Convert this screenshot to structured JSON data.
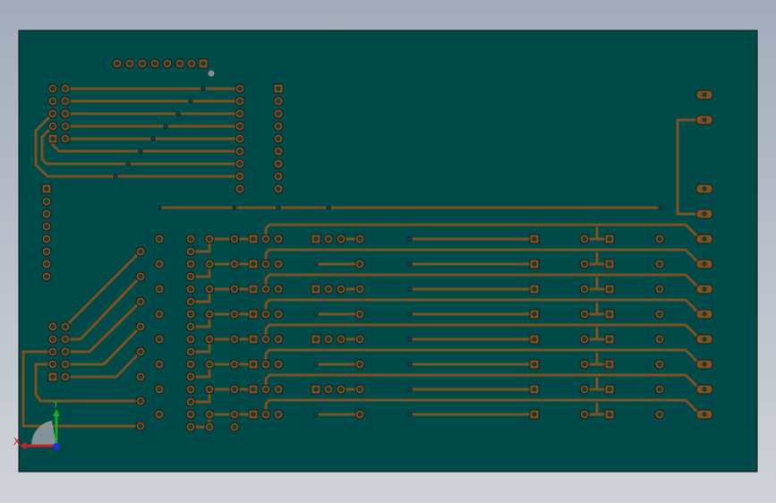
{
  "colors": {
    "board_fill": "#004a4a",
    "board_edge": "#101010",
    "trace": "#7d5120",
    "pad_fill": "#7d5120",
    "pad_hole": "#004a4a",
    "pad_outline": "#1c1c1c",
    "axis_x": "#cc2222",
    "axis_y": "#1faa1f",
    "axis_z": "#2233cc",
    "triad_sector": "#9aa0a8"
  },
  "triad": {
    "x_label": "X",
    "y_label": "Y"
  }
}
